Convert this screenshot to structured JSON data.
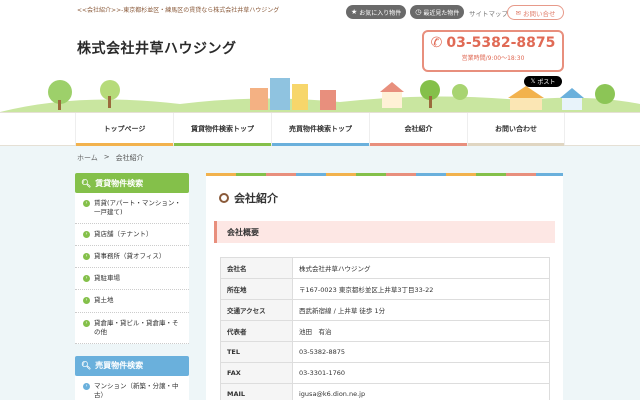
{
  "topbar": {
    "tagline": "<<会社紹介>>-東京都杉並区・練馬区の賃貸なら株式会社井草ハウジング",
    "favorites_label": "お気に入り物件",
    "recent_label": "最近見た物件",
    "sitemap_label": "サイトマップ",
    "contact_label": "お問い合せ"
  },
  "header": {
    "logo": "株式会社井草ハウジング",
    "phone": "03-5382-8875",
    "hours": "営業時間/9:00～18:30",
    "post_label": "ポスト"
  },
  "nav": {
    "items": [
      {
        "label": "トップページ",
        "color": "#f2b24d"
      },
      {
        "label": "賃貸物件検索トップ",
        "color": "#84c04a"
      },
      {
        "label": "売買物件検索トップ",
        "color": "#6ab0dc"
      },
      {
        "label": "会社紹介",
        "color": "#e88f7d"
      },
      {
        "label": "お問い合わせ",
        "color": "#e0d6c2"
      }
    ]
  },
  "breadcrumb": {
    "home": "ホーム",
    "sep": ">",
    "current": "会社紹介"
  },
  "sidebar": {
    "rent_title": "賃貸物件検索",
    "rent_items": [
      "賃貸(アパート・マンション・一戸建て)",
      "貸店舗（テナント）",
      "貸事務所（貸オフィス）",
      "貸駐車場",
      "貸土地",
      "貸倉庫・貸ビル・貸倉庫・その他"
    ],
    "sale_title": "売買物件検索",
    "sale_items": [
      "マンション（新築・分譲・中古）"
    ]
  },
  "content": {
    "title": "会社紹介",
    "section": "会社概要",
    "rows": [
      {
        "k": "会社名",
        "v": "株式会社井草ハウジング"
      },
      {
        "k": "所在地",
        "v": "〒167-0023 東京都杉並区上井草3丁目33-22"
      },
      {
        "k": "交通アクセス",
        "v": "西武新宿線 / 上井草 徒歩 1分"
      },
      {
        "k": "代表者",
        "v": "池田　有治"
      },
      {
        "k": "TEL",
        "v": "03-5382-8875"
      },
      {
        "k": "FAX",
        "v": "03-3301-1760"
      },
      {
        "k": "MAIL",
        "v": "igusa@k6.dion.ne.jp"
      }
    ]
  },
  "colors": {
    "accent": "#e88f7d",
    "green": "#84c04a",
    "blue": "#6ab0dc",
    "orange": "#f2b24d"
  }
}
